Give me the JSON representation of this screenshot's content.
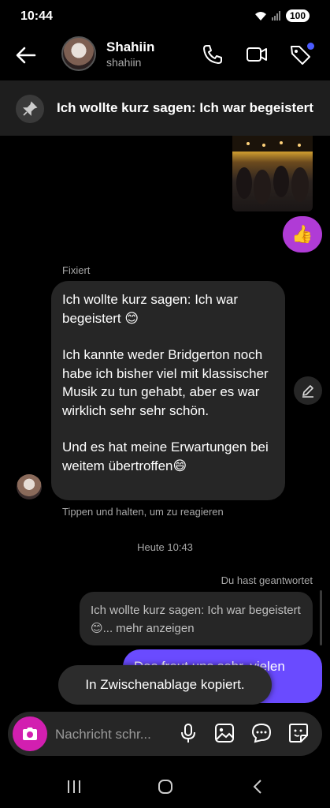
{
  "status_bar": {
    "time": "10:44",
    "battery": "100"
  },
  "header": {
    "contact_name": "Shahiin",
    "contact_handle": "shahiin"
  },
  "pinned_banner": {
    "text": "Ich wollte kurz sagen: Ich war begeistert"
  },
  "thread": {
    "pinned_label": "Fixiert",
    "pinned_message": {
      "p1": "Ich wollte kurz sagen: Ich war begeistert 😊",
      "p2": "Ich kannte weder Bridgerton noch habe ich bisher viel mit klassischer Musik zu tun gehabt, aber es war wirklich sehr sehr schön.",
      "p3": "Und es hat meine Erwartungen bei weitem übertroffen😄"
    },
    "react_hint": "Tippen und halten, um zu reagieren",
    "timestamp": "Heute 10:43",
    "replied_label": "Du hast geantwortet",
    "reply_quote": "Ich wollte kurz sagen: Ich war begeistert 😊... mehr anzeigen",
    "outgoing_message": "Das freut uns sehr, vielen",
    "like_emoji": "👍"
  },
  "toast": {
    "text": "In Zwischenablage kopiert."
  },
  "composer": {
    "placeholder": "Nachricht schr..."
  },
  "icons": [
    "back-icon",
    "phone-icon",
    "video-icon",
    "tag-icon",
    "pin-icon",
    "edit-icon",
    "camera-icon",
    "mic-icon",
    "gallery-icon",
    "chat-bubble-icon",
    "sticker-icon",
    "recent-apps-icon",
    "home-icon",
    "back-nav-icon"
  ],
  "colors": {
    "outgoing_bubble": "#6a4bff",
    "like_button": "#b03bd6",
    "camera_button": "#d21fb0",
    "incoming_bubble": "#262626"
  }
}
